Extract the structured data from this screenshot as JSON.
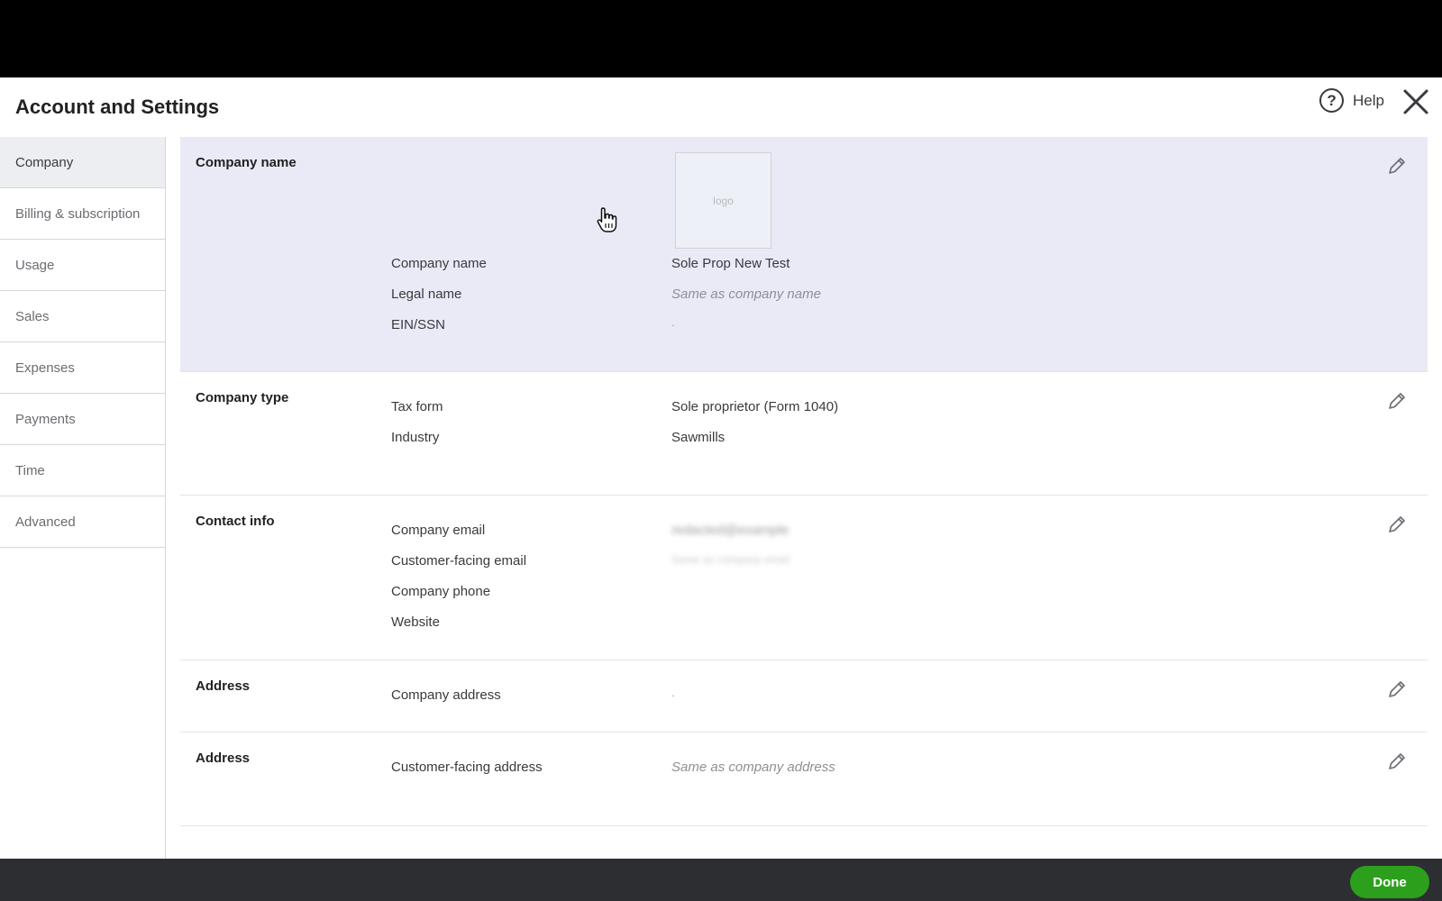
{
  "header": {
    "title": "Account and Settings",
    "help_label": "Help"
  },
  "sidebar": {
    "items": [
      {
        "label": "Company",
        "active": true
      },
      {
        "label": "Billing & subscription"
      },
      {
        "label": "Usage"
      },
      {
        "label": "Sales"
      },
      {
        "label": "Expenses"
      },
      {
        "label": "Payments"
      },
      {
        "label": "Time"
      },
      {
        "label": "Advanced"
      }
    ]
  },
  "sections": {
    "company_name": {
      "title": "Company name",
      "logo_label": "logo",
      "rows": [
        {
          "label": "Company name",
          "value": "Sole Prop New Test"
        },
        {
          "label": "Legal name",
          "value": "Same as company name"
        },
        {
          "label": "EIN/SSN",
          "value": "-"
        }
      ]
    },
    "company_type": {
      "title": "Company type",
      "rows": [
        {
          "label": "Tax form",
          "value": "Sole proprietor (Form 1040)"
        },
        {
          "label": "Industry",
          "value": "Sawmills"
        }
      ]
    },
    "contact_info": {
      "title": "Contact info",
      "rows": [
        {
          "label": "Company email",
          "value": "redacted@example"
        },
        {
          "label": "Customer-facing email",
          "value": "Same as company email"
        },
        {
          "label": "Company phone",
          "value": ""
        },
        {
          "label": "Website",
          "value": ""
        }
      ]
    },
    "address": {
      "title": "Address",
      "rows": [
        {
          "label": "Company address",
          "value": "-"
        }
      ]
    },
    "customer_address": {
      "title": "Address",
      "rows": [
        {
          "label": "Customer-facing address",
          "value": "Same as company address"
        }
      ]
    }
  },
  "footer": {
    "done_label": "Done"
  },
  "colors": {
    "accent_green": "#2ca01c",
    "highlight": "#e9eaf5"
  }
}
